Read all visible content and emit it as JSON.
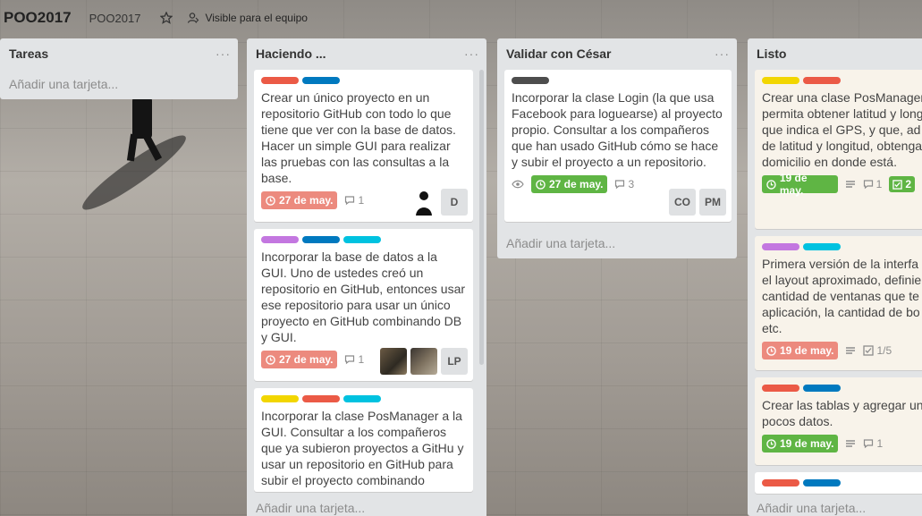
{
  "header": {
    "board_title": "POO2017",
    "org": "POO2017",
    "visibility": "Visible para el equipo"
  },
  "colors": {
    "red": "#eb5a46",
    "blue": "#0079bf",
    "sky": "#00c2e0",
    "purple": "#c377e0",
    "yellow": "#f2d600",
    "black": "#4d4d4d",
    "due_red": "#ec8a7e",
    "due_green": "#5fb544"
  },
  "lists": [
    {
      "title": "Tareas",
      "add_card": "Añadir una tarjeta..."
    },
    {
      "title": "Haciendo ...",
      "add_card": "Añadir una tarjeta..."
    },
    {
      "title": "Validar con César",
      "add_card": "Añadir una tarjeta..."
    },
    {
      "title": "Listo",
      "add_card": "Añadir una tarjeta..."
    }
  ],
  "cards": {
    "h1": {
      "labels": [
        "red",
        "blue"
      ],
      "text": "Crear un único proyecto en un repositorio GitHub con todo lo que tiene que ver con la base de datos. Hacer un simple GUI para realizar las pruebas con las consultas a la base.",
      "due": "27 de may.",
      "comments": "1",
      "members": [
        "D"
      ]
    },
    "h2": {
      "labels": [
        "purple",
        "blue",
        "sky"
      ],
      "text": "Incorporar la base de datos a la GUI. Uno de ustedes creó un repositorio en GitHub, entonces usar ese repositorio para usar un único proyecto en GitHub combinando DB y GUI.",
      "due": "27 de may.",
      "comments": "1",
      "members": [
        "LP"
      ]
    },
    "h3": {
      "labels": [
        "yellow",
        "red",
        "sky"
      ],
      "text": "Incorporar la clase PosManager a la GUI. Consultar a los compañeros que ya subieron proyectos a GitHu y usar un repositorio en GitHub para subir el proyecto combinando PosManager y GUI."
    },
    "v1": {
      "labels": [
        "black"
      ],
      "text": "Incorporar la clase Login (la que usa Facebook para loguearse) al proyecto propio. Consultar a los compañeros que han usado GitHub cómo se hace y subir el proyecto a un repositorio.",
      "due": "27 de may.",
      "comments": "3",
      "members": [
        "CO",
        "PM"
      ]
    },
    "l1": {
      "labels": [
        "yellow",
        "red"
      ],
      "text": "Crear una clase PosManager que\npermita obtener latitud y long\nque indica el GPS, y que, ad\nde latitud y longitud, obtenga\ndomicilio en donde está.",
      "due": "19 de may.",
      "comments": "1",
      "checklist": "2"
    },
    "l2": {
      "labels": [
        "purple",
        "sky"
      ],
      "text": "Primera versión de la interfa\nel layout aproximado, definie\ncantidad de ventanas que te\naplicación, la cantidad de bo\netc.",
      "due": "19 de may.",
      "checklist": "1/5"
    },
    "l3": {
      "labels": [
        "red",
        "blue"
      ],
      "text": "Crear las tablas y agregar un\npocos datos.",
      "due": "19 de may.",
      "comments": "1"
    },
    "l4": {
      "labels": [
        "red",
        "blue"
      ]
    }
  }
}
